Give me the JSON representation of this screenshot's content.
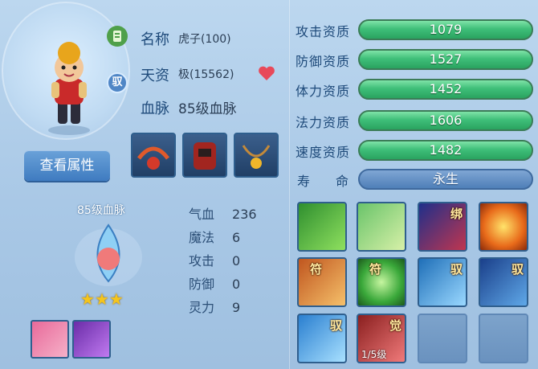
{
  "pet": {
    "name_label": "名称",
    "name_value": "虎子(100)",
    "aptitude_label": "天资",
    "aptitude_value": "极(15562)",
    "bloodline_label": "血脉",
    "bloodline_value": "85级血脉",
    "badge_mount": "驭",
    "view_attr_button": "查看属性"
  },
  "bloodline_panel": {
    "title": "85级血脉",
    "stars": 3,
    "stats": [
      {
        "label": "气血",
        "value": "236"
      },
      {
        "label": "魔法",
        "value": "6"
      },
      {
        "label": "攻击",
        "value": "0"
      },
      {
        "label": "防御",
        "value": "0"
      },
      {
        "label": "灵力",
        "value": "9"
      }
    ]
  },
  "qualities": [
    {
      "label": "攻击资质",
      "value": "1079"
    },
    {
      "label": "防御资质",
      "value": "1527"
    },
    {
      "label": "体力资质",
      "value": "1452"
    },
    {
      "label": "法力资质",
      "value": "1606"
    },
    {
      "label": "速度资质",
      "value": "1482"
    }
  ],
  "life": {
    "label_a": "寿",
    "label_b": "命",
    "value": "永生"
  },
  "skills": {
    "tag_bind": "绑",
    "tag_fu": "符",
    "tag_yu": "驭",
    "tag_jue": "觉",
    "awaken_level": "1/5级"
  },
  "colors": {
    "bar_green": "#3fbf79",
    "bar_blue": "#4f7fb8",
    "title_blue": "#1e4a7a",
    "heart_red": "#e8495a"
  }
}
